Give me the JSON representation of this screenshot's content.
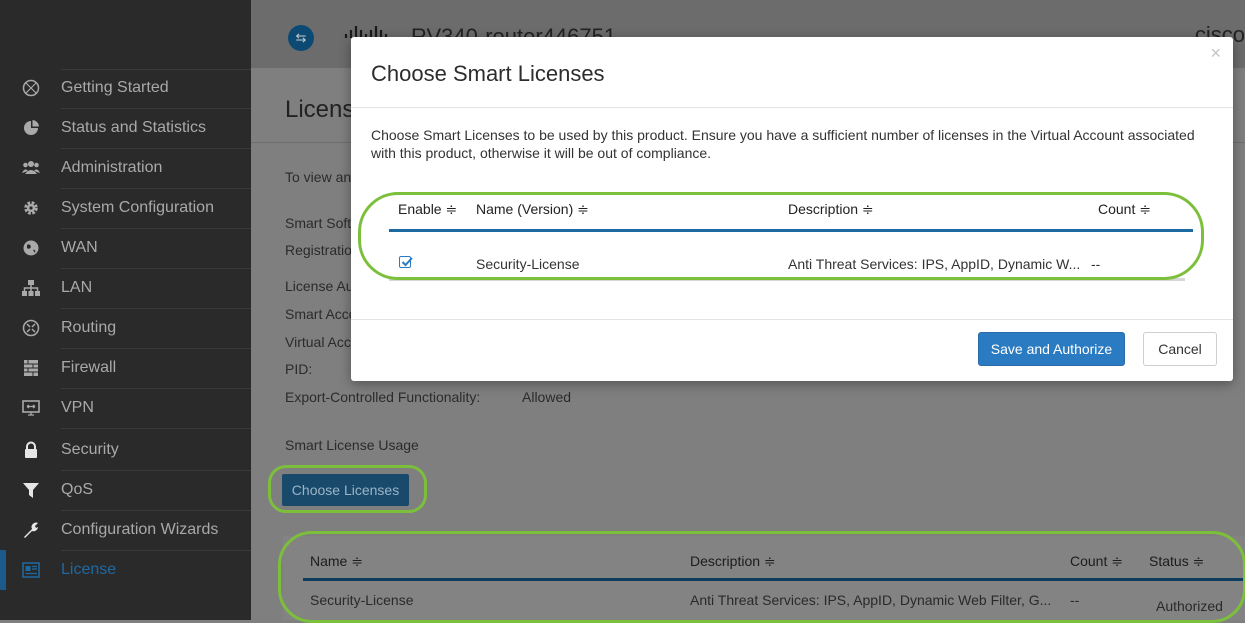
{
  "sidebar": {
    "items": [
      {
        "label": "Getting Started",
        "icon": "globe-icon"
      },
      {
        "label": "Status and Statistics",
        "icon": "pie-chart-icon"
      },
      {
        "label": "Administration",
        "icon": "users-icon"
      },
      {
        "label": "System Configuration",
        "icon": "gear-icon"
      },
      {
        "label": "WAN",
        "icon": "world-icon"
      },
      {
        "label": "LAN",
        "icon": "network-icon"
      },
      {
        "label": "Routing",
        "icon": "router-icon"
      },
      {
        "label": "Firewall",
        "icon": "firewall-icon"
      },
      {
        "label": "VPN",
        "icon": "vpn-icon"
      },
      {
        "label": "Security",
        "icon": "lock-icon"
      },
      {
        "label": "QoS",
        "icon": "filter-icon"
      },
      {
        "label": "Configuration Wizards",
        "icon": "wrench-icon"
      },
      {
        "label": "License",
        "icon": "license-icon",
        "active": true
      }
    ]
  },
  "header": {
    "router_name": "RV340-router446751",
    "brand": "cisco"
  },
  "page": {
    "title": "Licens",
    "intro": "To view an",
    "fields": [
      {
        "label": "Smart Soft",
        "value": ""
      },
      {
        "label": "Registratio",
        "value": ""
      },
      {
        "label": "License Au",
        "value": ""
      },
      {
        "label": "Smart Acco",
        "value": ""
      },
      {
        "label": "Virtual Acc",
        "value": ""
      },
      {
        "label": "PID:",
        "value": ""
      },
      {
        "label": "Export-Controlled Functionality:",
        "value": "Allowed"
      }
    ],
    "usage_label": "Smart License Usage",
    "choose_button": "Choose Licenses",
    "usage_table": {
      "headers": [
        "Name ≑",
        "Description ≑",
        "Count ≑",
        "Status ≑"
      ],
      "row": {
        "name": "Security-License",
        "description": "Anti Threat Services: IPS, AppID, Dynamic Web Filter, G...",
        "count": "--",
        "status": "Authorized"
      }
    }
  },
  "modal": {
    "title": "Choose Smart Licenses",
    "close": "×",
    "description": "Choose Smart Licenses to be used by this product. Ensure you have a sufficient number of licenses in the Virtual Account associated with this product, otherwise it will be out of compliance.",
    "table": {
      "headers": [
        "Enable ≑",
        "Name (Version) ≑",
        "Description ≑",
        "Count ≑"
      ],
      "row": {
        "enabled": true,
        "name": "Security-License",
        "description": "Anti Threat Services: IPS, AppID, Dynamic W...",
        "count": "--"
      }
    },
    "save_button": "Save and Authorize",
    "cancel_button": "Cancel"
  },
  "colors": {
    "sidebar_bg": "#2a2a2a",
    "accent": "#2b7bc2",
    "highlight_ring": "#7cbf3b"
  }
}
